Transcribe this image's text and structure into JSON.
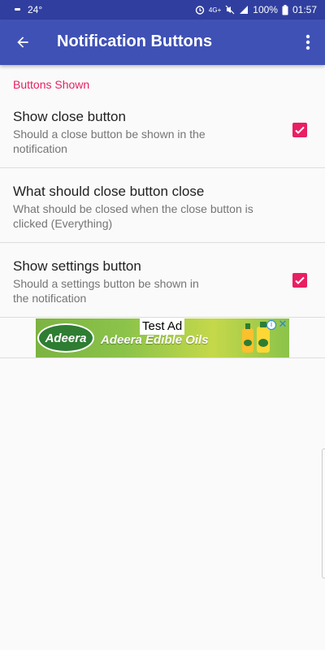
{
  "status_bar": {
    "temperature": "24°",
    "network": "4G+",
    "battery": "100%",
    "time": "01:57",
    "icons": [
      "notification-dot-icon",
      "alarm-icon",
      "mute-icon",
      "signal-icon",
      "battery-icon"
    ]
  },
  "app_bar": {
    "title": "Notification Buttons",
    "back_icon": "arrow-back-icon",
    "menu_icon": "more-vert-icon",
    "color": "#3f51b5",
    "status_color": "#303f9f"
  },
  "section": {
    "header": "Buttons Shown",
    "accent_color": "#e91e63"
  },
  "preferences": [
    {
      "title": "Show close button",
      "summary_lines": [
        "Should a close button be shown in the",
        "notification"
      ],
      "checked": true
    },
    {
      "title": "What should close button close",
      "summary_lines": [
        "What should be closed when the close button is",
        "clicked (Everything)"
      ],
      "checked": null
    },
    {
      "title": "Show settings button",
      "summary_lines": [
        "Should a settings button be shown in",
        "the notification"
      ],
      "checked": true
    }
  ],
  "ad": {
    "label": "Test Ad",
    "logo_text": "Adeera",
    "headline": "Adeera Edible Oils",
    "info_icon": "ad-info-icon",
    "close_icon": "ad-close-icon"
  }
}
